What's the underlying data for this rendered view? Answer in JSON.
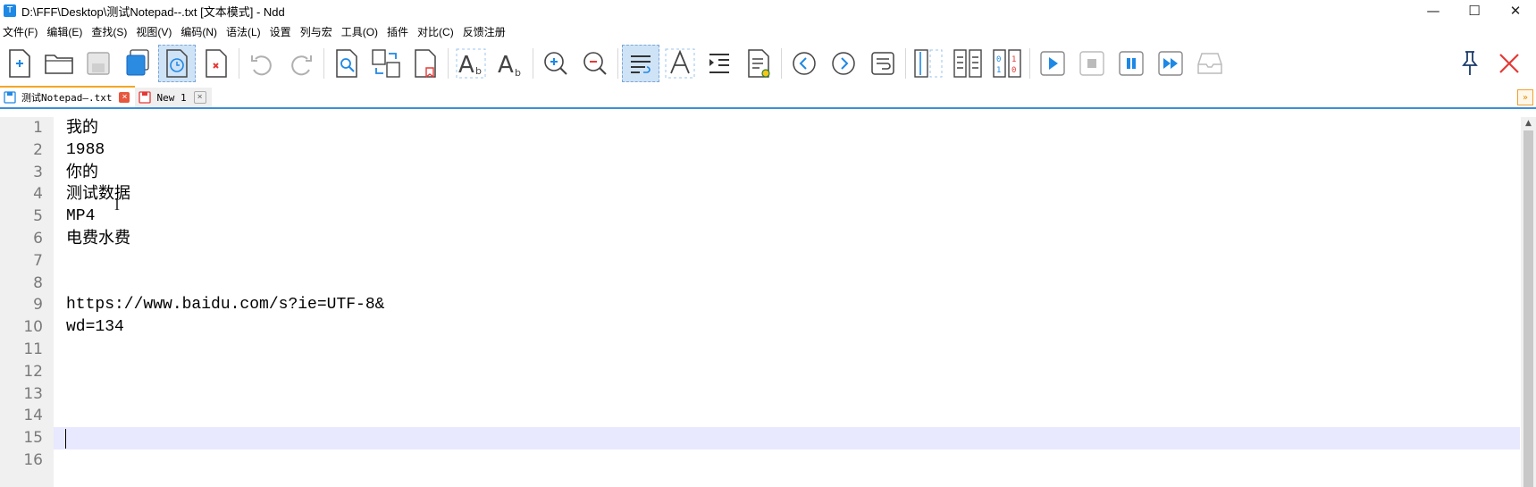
{
  "window": {
    "title": "D:\\FFF\\Desktop\\测试Notepad--.txt [文本模式] - Ndd",
    "app_icon_letter": "T",
    "minimize": "—",
    "maximize": "☐",
    "close": "✕"
  },
  "menu": [
    "文件(F)",
    "编辑(E)",
    "查找(S)",
    "视图(V)",
    "编码(N)",
    "语法(L)",
    "设置",
    "列与宏",
    "工具(O)",
    "插件",
    "对比(C)",
    "反馈注册"
  ],
  "tabs": [
    {
      "label": "测试Notepad—.txt",
      "close": "×"
    },
    {
      "label": "New 1",
      "close": "×"
    }
  ],
  "tab_dropdown": "»",
  "lines": [
    {
      "num": "1",
      "text": "我的"
    },
    {
      "num": "2",
      "text": "1988"
    },
    {
      "num": "3",
      "text": "你的"
    },
    {
      "num": "4",
      "text": "测试数据"
    },
    {
      "num": "5",
      "text": "MP4"
    },
    {
      "num": "6",
      "text": "电费水费"
    },
    {
      "num": "7",
      "text": ""
    },
    {
      "num": "8",
      "text": ""
    },
    {
      "num": "9",
      "text": "https://www.baidu.com/s?ie=UTF-8&"
    },
    {
      "num": "10",
      "text": "wd=134"
    },
    {
      "num": "11",
      "text": ""
    },
    {
      "num": "12",
      "text": ""
    },
    {
      "num": "13",
      "text": ""
    },
    {
      "num": "14",
      "text": ""
    },
    {
      "num": "15",
      "text": ""
    },
    {
      "num": "16",
      "text": ""
    }
  ],
  "colors": {
    "accent": "#1e88e5",
    "current_line": "#e8e8ff",
    "tab_close": "#e8573f"
  }
}
